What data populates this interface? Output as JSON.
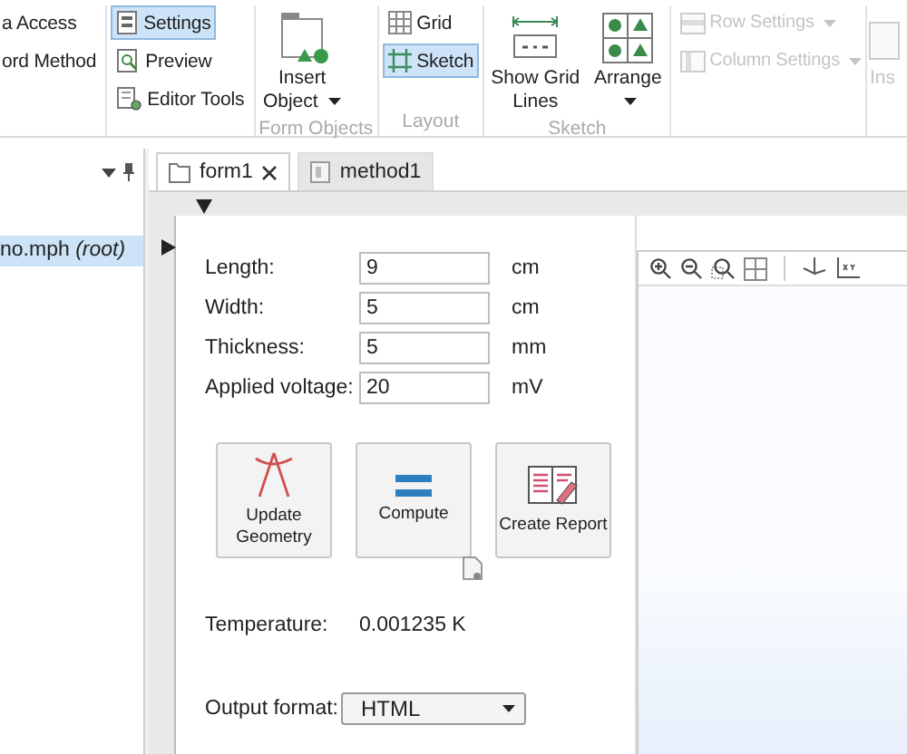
{
  "ribbon": {
    "groups": [
      {
        "items": [
          {
            "kind": "small",
            "label": "a Access",
            "selected": false,
            "disabled": false,
            "dropdown": false
          },
          {
            "kind": "small",
            "label": "ord Method",
            "selected": false,
            "disabled": false,
            "dropdown": false
          }
        ]
      },
      {
        "items": [
          {
            "kind": "small",
            "label": "Settings",
            "selected": true,
            "disabled": false,
            "dropdown": false
          },
          {
            "kind": "small",
            "label": "Preview",
            "selected": false,
            "disabled": false,
            "dropdown": false
          },
          {
            "kind": "small",
            "label": "Editor Tools",
            "selected": false,
            "disabled": false,
            "dropdown": false
          }
        ]
      },
      {
        "label": "Form Objects",
        "items": [
          {
            "kind": "large",
            "label": "Insert Object",
            "selected": false,
            "disabled": false,
            "dropdown": true
          }
        ]
      },
      {
        "label": "Layout",
        "items": [
          {
            "kind": "small",
            "label": "Grid",
            "selected": false,
            "disabled": false,
            "dropdown": false
          },
          {
            "kind": "small",
            "label": "Sketch",
            "selected": true,
            "disabled": false,
            "dropdown": false
          }
        ]
      },
      {
        "label": "Sketch",
        "items": [
          {
            "kind": "large",
            "label": "Show Grid Lines",
            "selected": false,
            "disabled": false,
            "dropdown": false
          },
          {
            "kind": "large",
            "label": "Arrange",
            "selected": false,
            "disabled": false,
            "dropdown": true
          }
        ]
      },
      {
        "items": [
          {
            "kind": "small",
            "label": "Row Settings",
            "selected": false,
            "disabled": true,
            "dropdown": true
          },
          {
            "kind": "small",
            "label": "Column Settings",
            "selected": false,
            "disabled": true,
            "dropdown": true
          }
        ]
      },
      {
        "items": [
          {
            "kind": "large",
            "label": "Ins",
            "selected": false,
            "disabled": true,
            "dropdown": false
          }
        ]
      }
    ]
  },
  "sidebar": {
    "items": [
      {
        "label": "no.mph *(root)*",
        "selected": true
      }
    ]
  },
  "editor": {
    "tabs": [
      {
        "label": "form1",
        "selected": true,
        "closable": true
      },
      {
        "label": "method1",
        "selected": false,
        "closable": false
      }
    ],
    "fields": [
      {
        "label": "Length:",
        "value": "9",
        "unit": "cm"
      },
      {
        "label": "Width:",
        "value": "5",
        "unit": "cm"
      },
      {
        "label": "Thickness:",
        "value": "5",
        "unit": "mm"
      },
      {
        "label": "Applied voltage:",
        "value": "20",
        "unit": "mV"
      }
    ],
    "buttons": [
      {
        "label": "Update Geometry"
      },
      {
        "label": "Compute"
      },
      {
        "label": "Create Report"
      }
    ],
    "result": {
      "label": "Temperature:",
      "value": "0.001235 K"
    },
    "output": {
      "label": "Output format:",
      "value": "HTML"
    }
  }
}
